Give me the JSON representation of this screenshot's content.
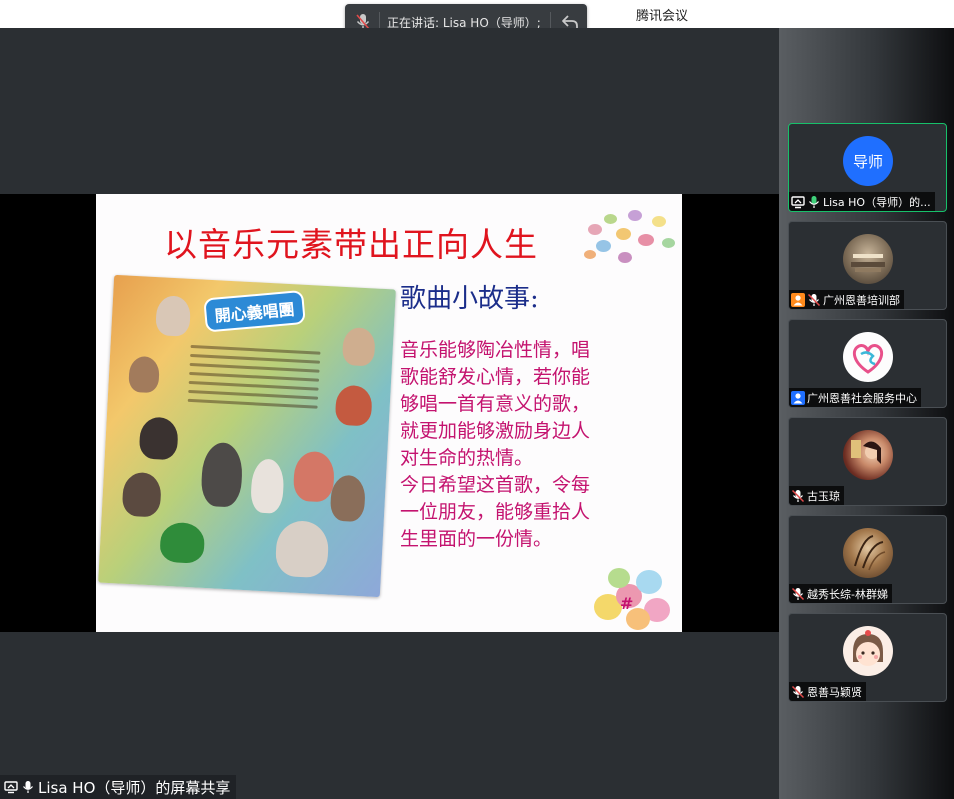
{
  "app": {
    "title": "腾讯会议"
  },
  "speaking": {
    "label": "正在讲话: Lisa HO（导师）;"
  },
  "slide": {
    "title": "以音乐元素带出正向人生",
    "subtitle": "歌曲小故事:",
    "body_lines": [
      "音乐能够陶冶性情，唱",
      "歌能舒发心情，若你能",
      "够唱一首有意义的歌，",
      "就更加能够激励身边人",
      "对生命的热情。",
      "今日希望这首歌，令每",
      "一位朋友，能够重拾人",
      "生里面的一份情。"
    ],
    "poster_heading": "開心義唱團",
    "hash_mark": "#"
  },
  "share_label": "Lisa HO（导师）的屏幕共享",
  "participants": [
    {
      "name": "Lisa HO（导师）的...",
      "avatar_text": "导师",
      "icons": [
        "screen-share-icon",
        "mic-on-icon"
      ],
      "active": true
    },
    {
      "name": "广州恩善培训部",
      "icons": [
        "user-badge-icon",
        "mic-off-icon"
      ]
    },
    {
      "name": "广州恩善社会服务中心",
      "icons": [
        "user-badge-icon"
      ]
    },
    {
      "name": "古玉琼",
      "icons": [
        "mic-off-icon"
      ]
    },
    {
      "name": "越秀长综-林群娣",
      "icons": [
        "mic-off-icon"
      ]
    },
    {
      "name": "恩善马颖贤",
      "icons": [
        "mic-off-icon"
      ]
    }
  ],
  "colors": {
    "active_border": "#17c06a",
    "avatar_blue": "#1f6fff",
    "title_red": "#e0141e",
    "subtitle_blue": "#1b2d8a",
    "body_magenta": "#c4136f",
    "user_badge_orange": "#ff8a1c",
    "user_badge_blue": "#1f6fff"
  }
}
